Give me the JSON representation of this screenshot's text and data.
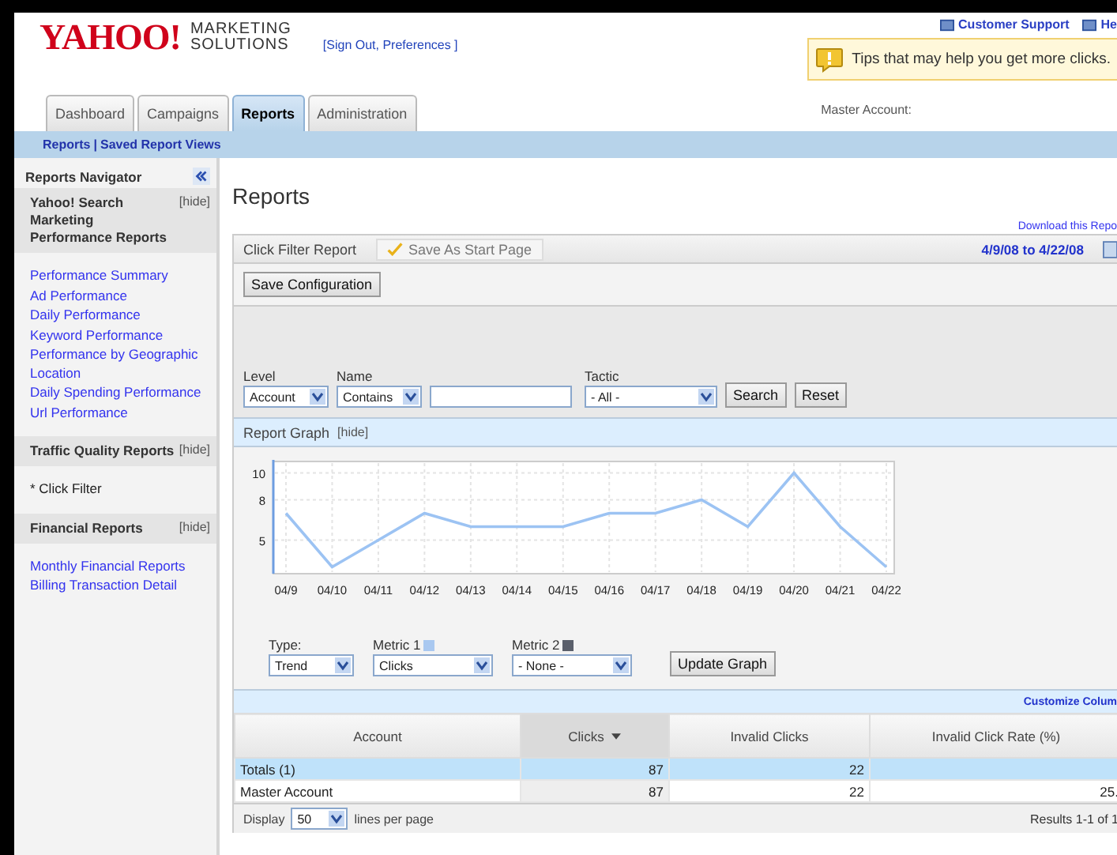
{
  "header": {
    "logo": {
      "brand": "YAHOO!",
      "line_1": "MARKETING",
      "line_2": "SOLUTIONS"
    },
    "account_links": "[Sign Out, Preferences ]",
    "top_links": [
      "Customer Support",
      "He"
    ],
    "tip": "Tips that may help you get more clicks.",
    "account_label": "Master Account:"
  },
  "tabs": [
    {
      "label": "Dashboard",
      "selected": false
    },
    {
      "label": "Campaigns",
      "selected": false
    },
    {
      "label": "Reports",
      "selected": true
    },
    {
      "label": "Administration",
      "selected": false
    }
  ],
  "subnav": [
    "Reports",
    "Saved Report Views"
  ],
  "subnav_separator": "|",
  "sidebar": {
    "title": "Reports Navigator",
    "sections": [
      {
        "title": "Yahoo! Search Marketing Performance Reports",
        "hide": "[hide]",
        "items": [
          {
            "label": "Performance Summary",
            "selected": false
          },
          {
            "label": "Ad Performance",
            "selected": false
          },
          {
            "label": "Daily Performance",
            "selected": false
          },
          {
            "label": "Keyword Performance",
            "selected": false
          },
          {
            "label": "Performance by Geographic Location",
            "selected": false
          },
          {
            "label": "Daily Spending Performance",
            "selected": false
          },
          {
            "label": "Url Performance",
            "selected": false
          }
        ]
      },
      {
        "title": "Traffic Quality Reports",
        "hide": "[hide]",
        "items": [
          {
            "label": "* Click Filter",
            "selected": true
          }
        ]
      },
      {
        "title": "Financial Reports",
        "hide": "[hide]",
        "items": [
          {
            "label": "Monthly Financial Reports",
            "selected": false
          },
          {
            "label": "Billing Transaction Detail",
            "selected": false
          }
        ]
      }
    ]
  },
  "page_title": "Reports",
  "download_link": "Download this Repo",
  "report": {
    "name": "Click Filter Report",
    "start_page_button": "Save As Start Page",
    "date_range": "4/9/08 to 4/22/08",
    "save_button": "Save Configuration"
  },
  "filters": [
    {
      "kind": "select",
      "label": "Level",
      "value": "Account"
    },
    {
      "kind": "select",
      "label": "Name",
      "value": "Contains"
    },
    {
      "kind": "input"
    },
    {
      "kind": "select",
      "label": "Tactic",
      "value": "- All -"
    }
  ],
  "filter_buttons": [
    "Search",
    "Reset"
  ],
  "graph": {
    "title": "Report Graph",
    "hide": "[hide]",
    "chart_data": {
      "type": "line",
      "categories": [
        "04/9",
        "04/10",
        "04/11",
        "04/12",
        "04/13",
        "04/14",
        "04/15",
        "04/16",
        "04/17",
        "04/18",
        "04/19",
        "04/20",
        "04/21",
        "04/22"
      ],
      "ylim": [
        2.5,
        10.5
      ],
      "yticks": [
        5,
        8,
        10
      ],
      "grid": true,
      "series": [
        {
          "color": "#9cc3f3",
          "values": [
            7,
            3,
            5,
            7,
            6,
            6,
            6,
            7,
            7,
            8,
            6,
            10,
            6,
            3
          ]
        }
      ]
    },
    "controls": [
      {
        "label": "Type:",
        "value": "Trend"
      },
      {
        "label": "Metric 1",
        "value": "Clicks",
        "color": "#a9c8f0"
      },
      {
        "label": "Metric 2",
        "value": "- None -",
        "color": "#5a5f6b"
      }
    ],
    "update_button": "Update Graph"
  },
  "customize_link": "Customize Colum",
  "table": {
    "columns": [
      {
        "label": "Account",
        "sorted": false
      },
      {
        "label": "Clicks",
        "sorted": true
      },
      {
        "label": "Invalid Clicks",
        "sorted": false
      },
      {
        "label": "Invalid Click Rate (%)",
        "sorted": false
      }
    ],
    "rows": [
      {
        "kind": "total",
        "cells": [
          "Totals (1)",
          "87",
          "22",
          ""
        ]
      },
      {
        "kind": "data",
        "cells": [
          "Master Account",
          "87",
          "22",
          "25."
        ]
      }
    ]
  },
  "footer": {
    "display_label": "Display",
    "page_size": "50",
    "lines_label": "lines per page",
    "results": "Results 1-1 of 1"
  }
}
